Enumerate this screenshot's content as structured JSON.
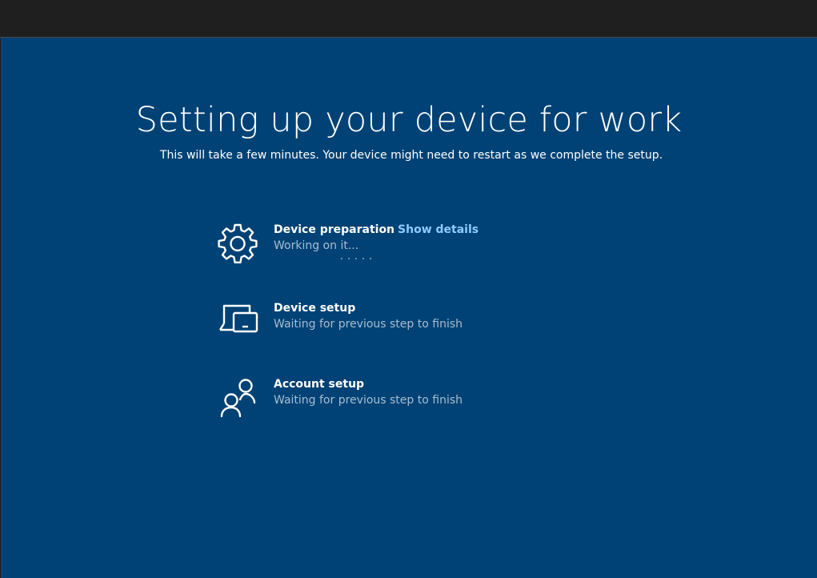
{
  "header": {
    "title": "Setting up your device for work",
    "subtitle": "This will take a few minutes. Your device might need to restart as we complete the setup."
  },
  "steps": [
    {
      "icon": "gear-icon",
      "label": "Device preparation",
      "link": "Show details",
      "status": "Working on it..."
    },
    {
      "icon": "device-icon",
      "label": "Device setup",
      "status": "Waiting for previous step to finish"
    },
    {
      "icon": "people-icon",
      "label": "Account setup",
      "status": "Waiting for previous step to finish"
    }
  ],
  "colors": {
    "background": "#004275",
    "link": "#8fcaff",
    "status_text": "#a9bdd1"
  }
}
